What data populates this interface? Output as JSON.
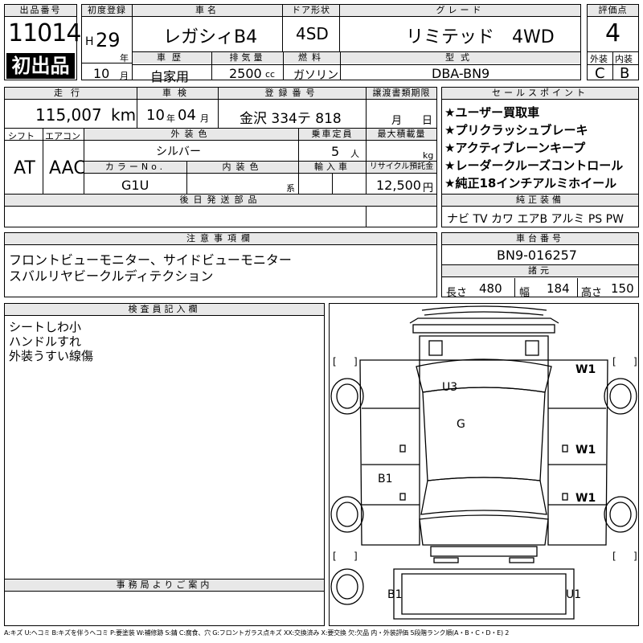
{
  "lot": {
    "label": "出品番号",
    "number": "11014",
    "badge": "初出品"
  },
  "registration": {
    "label": "初度登録",
    "era": "H",
    "year": "29",
    "year_unit": "年",
    "month": "10",
    "month_unit": "月"
  },
  "car": {
    "name_label": "車名",
    "name": "レガシィB4",
    "door_label": "ドア形状",
    "door": "4SD",
    "grade_label": "グレード",
    "grade": "リミテッド　4WD"
  },
  "score": {
    "label": "評価点",
    "value": "4",
    "ext_label": "外装",
    "int_label": "内装",
    "ext": "C",
    "int": "B"
  },
  "history": {
    "label": "車歴",
    "value": "自家用"
  },
  "displacement": {
    "label": "排気量",
    "value": "2500",
    "unit": "cc"
  },
  "fuel": {
    "label": "燃料",
    "value": "ガソリン"
  },
  "model_code": {
    "label": "型式",
    "value": "DBA-BN9"
  },
  "mileage": {
    "label": "走行",
    "value": "115,007",
    "unit": "km"
  },
  "inspection": {
    "label": "車検",
    "year": "10",
    "year_unit": "年",
    "month": "04",
    "month_unit": "月"
  },
  "plate": {
    "label": "登録番号",
    "value": "金沢 334テ 818"
  },
  "transfer": {
    "label": "譲渡書類期限",
    "month_unit": "月",
    "day_unit": "日"
  },
  "sales_points": {
    "label": "セールスポイント",
    "items": [
      "★ユーザー買取車",
      "★プリクラッシュブレーキ",
      "★アクティブレーンキープ",
      "★レーダークルーズコントロール",
      "★純正18インチアルミホイール"
    ]
  },
  "shift": {
    "label": "シフト",
    "value": "AT"
  },
  "aircon": {
    "label": "エアコン",
    "value": "AAC"
  },
  "exterior_color": {
    "label": "外装色",
    "value": "シルバー"
  },
  "capacity": {
    "label": "乗車定員",
    "value": "5",
    "unit": "人"
  },
  "max_load": {
    "label": "最大積載量",
    "unit": "kg"
  },
  "color_no": {
    "label": "カラーNo.",
    "value": "G1U"
  },
  "interior_color": {
    "label": "内装色",
    "unit": "系"
  },
  "import": {
    "label": "輸入車"
  },
  "recycle": {
    "label": "リサイクル預託金",
    "value": "12,500",
    "unit": "円"
  },
  "later_parts": {
    "label": "後日発送部品"
  },
  "genuine_equipment": {
    "label": "純正装備",
    "value": "ナビ  TV  カワ  エアB  アルミ  PS  PW"
  },
  "notes": {
    "label": "注意事項欄",
    "lines": [
      "フロントビューモニター、サイドビューモニター",
      "スバルリヤビークルディテクション"
    ]
  },
  "chassis": {
    "label": "車台番号",
    "value": "BN9-016257"
  },
  "dimensions": {
    "label": "諸元",
    "length_label": "長さ",
    "length": "480",
    "width_label": "幅",
    "width": "184",
    "height_label": "高さ",
    "height": "150"
  },
  "inspector": {
    "label": "検査員記入欄",
    "lines": [
      "シートしわ小",
      "ハンドルすれ",
      "外装うすい線傷"
    ]
  },
  "office": {
    "label": "事務局よりご案内"
  },
  "diagram": {
    "marks": {
      "roof": "U3",
      "glass": "G",
      "front_right": "W1",
      "right_door_front": "W1",
      "right_door_rear": "W1",
      "left_rear": "B1",
      "bottom_left": "B1",
      "bottom_right": "U1"
    },
    "bracket_open": "[",
    "bracket_close": "]"
  },
  "legend": "A:キズ U:ヘコミ B:キズを伴うヘコミ P:要塗装 W:補修跡 S:錆 C:腐食、穴 G:フロントガラス点キズ XX:交換済み X:要交換 欠:欠品 内・外装評価 5段階ランク順(A・B・C・D・E) 2"
}
